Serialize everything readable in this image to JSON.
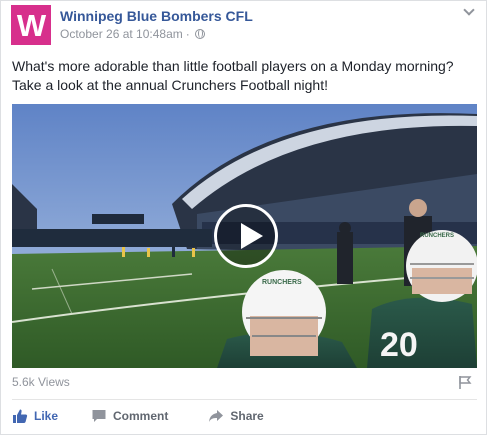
{
  "post": {
    "page_name": "Winnipeg Blue Bombers CFL",
    "avatar_letter": "W",
    "timestamp": "October 26 at 10:48am",
    "separator": "·",
    "text_line1": "What's more adorable than little football players on a Monday morning?",
    "text_line2": "Take a look at the annual Crunchers Football night!"
  },
  "video": {
    "jersey_number": "20",
    "helmet_text_left": "RUNCHERS",
    "helmet_text_right": "RUNCHERS"
  },
  "stats": {
    "views": "5.6k Views"
  },
  "actions": {
    "like": "Like",
    "comment": "Comment",
    "share": "Share"
  },
  "colors": {
    "brand_avatar": "#d72f8c",
    "link_blue": "#365899",
    "like_blue": "#4267b2",
    "meta_gray": "#90949c"
  },
  "icons": [
    "chevron-down-icon",
    "globe-icon",
    "play-icon",
    "flag-icon",
    "thumbs-up-icon",
    "comment-icon",
    "share-icon"
  ]
}
